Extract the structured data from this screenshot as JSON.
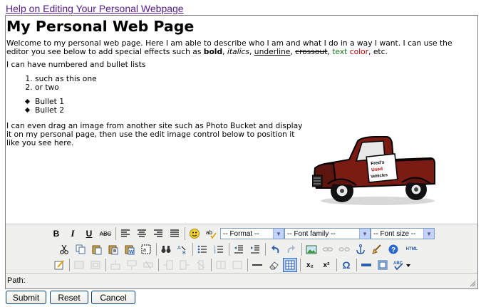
{
  "help_link": "Help on Editing Your Personal Webpage",
  "content": {
    "title": "My Personal Web Page",
    "intro": {
      "text_a": "Welcome to my personal web page.  Here I am able to describe who I am and what I do in a way I want.  I can use the editor you see below to add special effects such as ",
      "bold": "bold",
      "sep1": ", ",
      "italics": "italics",
      "sep2": ", ",
      "underline": "underline",
      "sep3": ", ",
      "crossout": "crossout",
      "sep4": ", ",
      "text_color": "text color",
      "sep5": ", ",
      "etc": "etc.",
      "text_color_value": "#1a7a1a",
      "color_value": "#c00000"
    },
    "lists_intro": "I can have numbered and bullet lists",
    "numbered": [
      "such as this one",
      "or two"
    ],
    "bullets": [
      "Bullet 1",
      "Bullet 2"
    ],
    "drag_text": "I can even drag an image from another site such as Photo Bucket and display it on my personal page, then use the edit image control below to position it like you see here.",
    "truck_sign": [
      "Fred's",
      "Used",
      "Vehicles"
    ]
  },
  "toolbar": {
    "format_select": "-- Format --",
    "font_family_select": "-- Font family --",
    "font_size_select": "-- Font size --",
    "bold": "B",
    "italic": "I",
    "underline": "U",
    "strike": "ABC",
    "html": "HTML",
    "subscript": "x₂",
    "superscript": "x²",
    "omega": "Ω"
  },
  "path_label": "Path:",
  "buttons": {
    "submit": "Submit",
    "reset": "Reset",
    "cancel": "Cancel"
  }
}
